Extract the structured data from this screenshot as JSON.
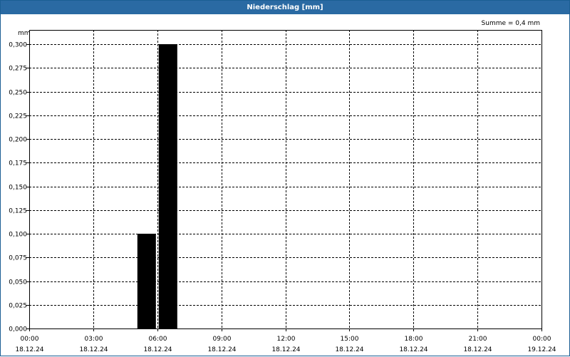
{
  "window": {
    "title": "Niederschlag [mm]"
  },
  "chart_data": {
    "type": "bar",
    "title": "Niederschlag [mm]",
    "annotation": "Summe = 0,4 mm",
    "ylabel": "mm",
    "ylim": [
      0,
      0.3
    ],
    "xlim": [
      "18.12.24 00:00",
      "19.12.24 00:00"
    ],
    "grid": true,
    "bar_color": "#000000",
    "y_ticks": [
      "0,000",
      "0,025",
      "0,050",
      "0,075",
      "0,100",
      "0,125",
      "0,150",
      "0,175",
      "0,200",
      "0,225",
      "0,250",
      "0,275",
      "0,300"
    ],
    "x_ticks": [
      {
        "time": "00:00",
        "date": "18.12.24"
      },
      {
        "time": "03:00",
        "date": "18.12.24"
      },
      {
        "time": "06:00",
        "date": "18.12.24"
      },
      {
        "time": "09:00",
        "date": "18.12.24"
      },
      {
        "time": "12:00",
        "date": "18.12.24"
      },
      {
        "time": "15:00",
        "date": "18.12.24"
      },
      {
        "time": "18:00",
        "date": "18.12.24"
      },
      {
        "time": "21:00",
        "date": "18.12.24"
      },
      {
        "time": "00:00",
        "date": "19.12.24"
      }
    ],
    "bars": [
      {
        "start": "18.12.24 05:00",
        "end": "18.12.24 06:00",
        "value": 0.1
      },
      {
        "start": "18.12.24 06:00",
        "end": "18.12.24 07:00",
        "value": 0.3
      }
    ]
  }
}
